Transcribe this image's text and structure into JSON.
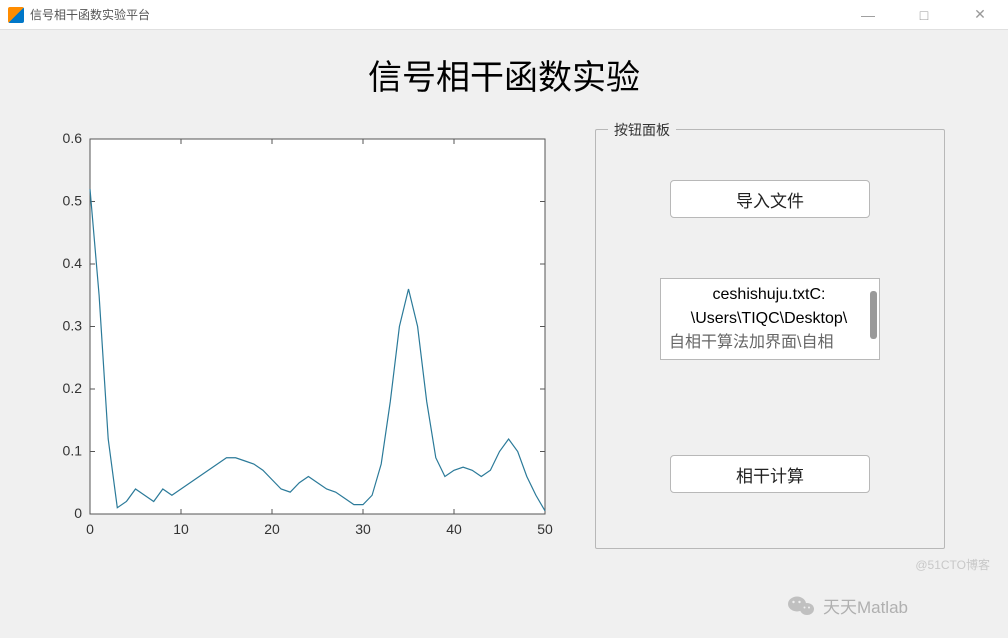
{
  "window": {
    "title": "信号相干函数实验平台",
    "minimize": "—",
    "maximize": "□",
    "close": "✕"
  },
  "header": {
    "title": "信号相干函数实验"
  },
  "panel": {
    "legend": "按钮面板",
    "import_button": "导入文件",
    "compute_button": "相干计算",
    "file_text_line1": "ceshishuju.txtC:",
    "file_text_line2": "\\Users\\TIQC\\Desktop\\",
    "file_text_line3": "自相干算法加界面\\自相"
  },
  "watermark": {
    "wechat": "天天Matlab",
    "blog": "@51CTO博客"
  },
  "chart_data": {
    "type": "line",
    "xlabel": "",
    "ylabel": "",
    "xlim": [
      0,
      50
    ],
    "ylim": [
      0,
      0.6
    ],
    "x_ticks": [
      0,
      10,
      20,
      30,
      40,
      50
    ],
    "y_ticks": [
      0,
      0.1,
      0.2,
      0.3,
      0.4,
      0.5,
      0.6
    ],
    "x": [
      0,
      1,
      2,
      3,
      4,
      5,
      6,
      7,
      8,
      9,
      10,
      11,
      12,
      13,
      14,
      15,
      16,
      17,
      18,
      19,
      20,
      21,
      22,
      23,
      24,
      25,
      26,
      27,
      28,
      29,
      30,
      31,
      32,
      33,
      34,
      35,
      36,
      37,
      38,
      39,
      40,
      41,
      42,
      43,
      44,
      45,
      46,
      47,
      48,
      49,
      50
    ],
    "y": [
      0.52,
      0.35,
      0.12,
      0.01,
      0.02,
      0.04,
      0.03,
      0.02,
      0.04,
      0.03,
      0.04,
      0.05,
      0.06,
      0.07,
      0.08,
      0.09,
      0.09,
      0.085,
      0.08,
      0.07,
      0.055,
      0.04,
      0.035,
      0.05,
      0.06,
      0.05,
      0.04,
      0.035,
      0.025,
      0.015,
      0.015,
      0.03,
      0.08,
      0.18,
      0.3,
      0.36,
      0.3,
      0.18,
      0.09,
      0.06,
      0.07,
      0.075,
      0.07,
      0.06,
      0.07,
      0.1,
      0.12,
      0.1,
      0.06,
      0.03,
      0.005
    ]
  }
}
